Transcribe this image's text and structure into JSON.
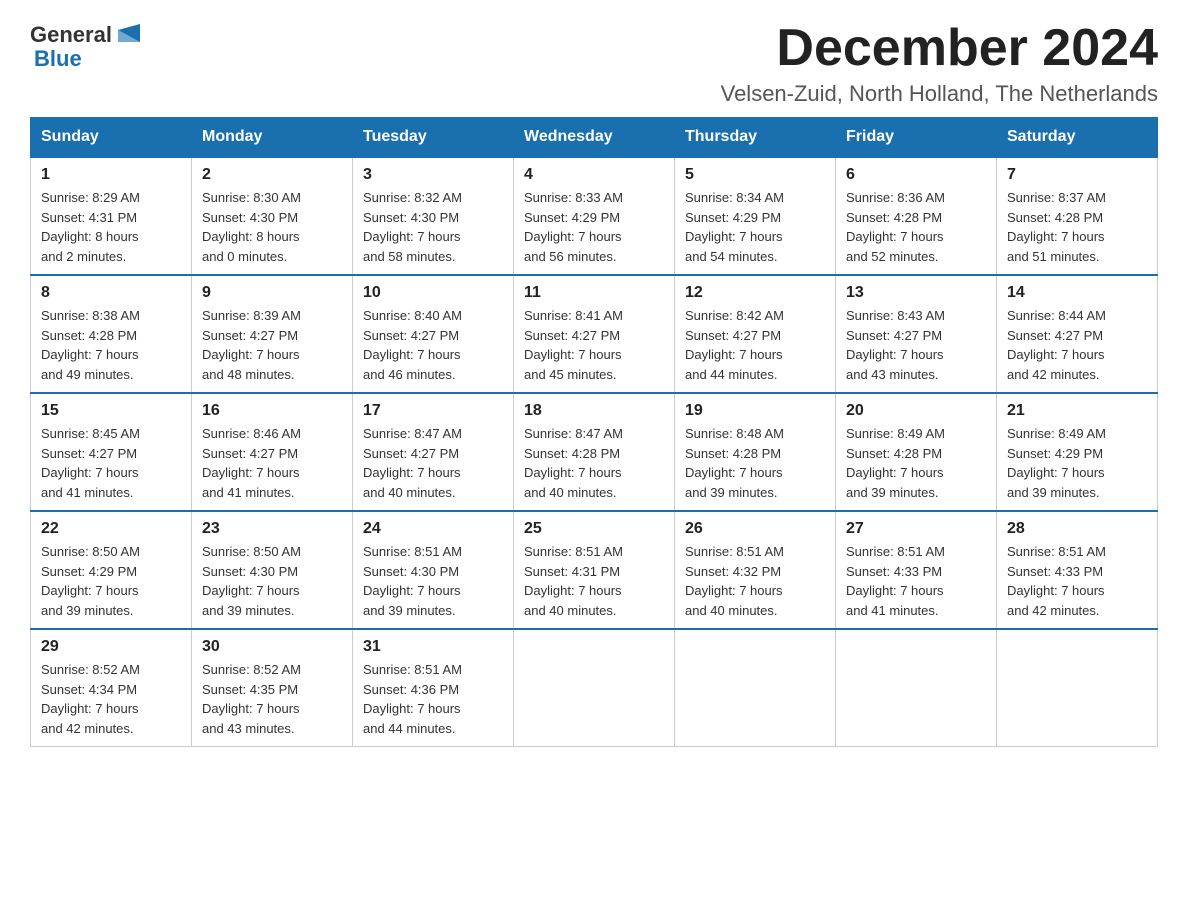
{
  "header": {
    "logo_text_black": "General",
    "logo_text_blue": "Blue",
    "month_year": "December 2024",
    "location": "Velsen-Zuid, North Holland, The Netherlands"
  },
  "days_of_week": [
    "Sunday",
    "Monday",
    "Tuesday",
    "Wednesday",
    "Thursday",
    "Friday",
    "Saturday"
  ],
  "weeks": [
    [
      {
        "day": "1",
        "sunrise": "8:29 AM",
        "sunset": "4:31 PM",
        "daylight": "8 hours and 2 minutes."
      },
      {
        "day": "2",
        "sunrise": "8:30 AM",
        "sunset": "4:30 PM",
        "daylight": "8 hours and 0 minutes."
      },
      {
        "day": "3",
        "sunrise": "8:32 AM",
        "sunset": "4:30 PM",
        "daylight": "7 hours and 58 minutes."
      },
      {
        "day": "4",
        "sunrise": "8:33 AM",
        "sunset": "4:29 PM",
        "daylight": "7 hours and 56 minutes."
      },
      {
        "day": "5",
        "sunrise": "8:34 AM",
        "sunset": "4:29 PM",
        "daylight": "7 hours and 54 minutes."
      },
      {
        "day": "6",
        "sunrise": "8:36 AM",
        "sunset": "4:28 PM",
        "daylight": "7 hours and 52 minutes."
      },
      {
        "day": "7",
        "sunrise": "8:37 AM",
        "sunset": "4:28 PM",
        "daylight": "7 hours and 51 minutes."
      }
    ],
    [
      {
        "day": "8",
        "sunrise": "8:38 AM",
        "sunset": "4:28 PM",
        "daylight": "7 hours and 49 minutes."
      },
      {
        "day": "9",
        "sunrise": "8:39 AM",
        "sunset": "4:27 PM",
        "daylight": "7 hours and 48 minutes."
      },
      {
        "day": "10",
        "sunrise": "8:40 AM",
        "sunset": "4:27 PM",
        "daylight": "7 hours and 46 minutes."
      },
      {
        "day": "11",
        "sunrise": "8:41 AM",
        "sunset": "4:27 PM",
        "daylight": "7 hours and 45 minutes."
      },
      {
        "day": "12",
        "sunrise": "8:42 AM",
        "sunset": "4:27 PM",
        "daylight": "7 hours and 44 minutes."
      },
      {
        "day": "13",
        "sunrise": "8:43 AM",
        "sunset": "4:27 PM",
        "daylight": "7 hours and 43 minutes."
      },
      {
        "day": "14",
        "sunrise": "8:44 AM",
        "sunset": "4:27 PM",
        "daylight": "7 hours and 42 minutes."
      }
    ],
    [
      {
        "day": "15",
        "sunrise": "8:45 AM",
        "sunset": "4:27 PM",
        "daylight": "7 hours and 41 minutes."
      },
      {
        "day": "16",
        "sunrise": "8:46 AM",
        "sunset": "4:27 PM",
        "daylight": "7 hours and 41 minutes."
      },
      {
        "day": "17",
        "sunrise": "8:47 AM",
        "sunset": "4:27 PM",
        "daylight": "7 hours and 40 minutes."
      },
      {
        "day": "18",
        "sunrise": "8:47 AM",
        "sunset": "4:28 PM",
        "daylight": "7 hours and 40 minutes."
      },
      {
        "day": "19",
        "sunrise": "8:48 AM",
        "sunset": "4:28 PM",
        "daylight": "7 hours and 39 minutes."
      },
      {
        "day": "20",
        "sunrise": "8:49 AM",
        "sunset": "4:28 PM",
        "daylight": "7 hours and 39 minutes."
      },
      {
        "day": "21",
        "sunrise": "8:49 AM",
        "sunset": "4:29 PM",
        "daylight": "7 hours and 39 minutes."
      }
    ],
    [
      {
        "day": "22",
        "sunrise": "8:50 AM",
        "sunset": "4:29 PM",
        "daylight": "7 hours and 39 minutes."
      },
      {
        "day": "23",
        "sunrise": "8:50 AM",
        "sunset": "4:30 PM",
        "daylight": "7 hours and 39 minutes."
      },
      {
        "day": "24",
        "sunrise": "8:51 AM",
        "sunset": "4:30 PM",
        "daylight": "7 hours and 39 minutes."
      },
      {
        "day": "25",
        "sunrise": "8:51 AM",
        "sunset": "4:31 PM",
        "daylight": "7 hours and 40 minutes."
      },
      {
        "day": "26",
        "sunrise": "8:51 AM",
        "sunset": "4:32 PM",
        "daylight": "7 hours and 40 minutes."
      },
      {
        "day": "27",
        "sunrise": "8:51 AM",
        "sunset": "4:33 PM",
        "daylight": "7 hours and 41 minutes."
      },
      {
        "day": "28",
        "sunrise": "8:51 AM",
        "sunset": "4:33 PM",
        "daylight": "7 hours and 42 minutes."
      }
    ],
    [
      {
        "day": "29",
        "sunrise": "8:52 AM",
        "sunset": "4:34 PM",
        "daylight": "7 hours and 42 minutes."
      },
      {
        "day": "30",
        "sunrise": "8:52 AM",
        "sunset": "4:35 PM",
        "daylight": "7 hours and 43 minutes."
      },
      {
        "day": "31",
        "sunrise": "8:51 AM",
        "sunset": "4:36 PM",
        "daylight": "7 hours and 44 minutes."
      },
      null,
      null,
      null,
      null
    ]
  ],
  "labels": {
    "sunrise": "Sunrise:",
    "sunset": "Sunset:",
    "daylight": "Daylight:"
  }
}
